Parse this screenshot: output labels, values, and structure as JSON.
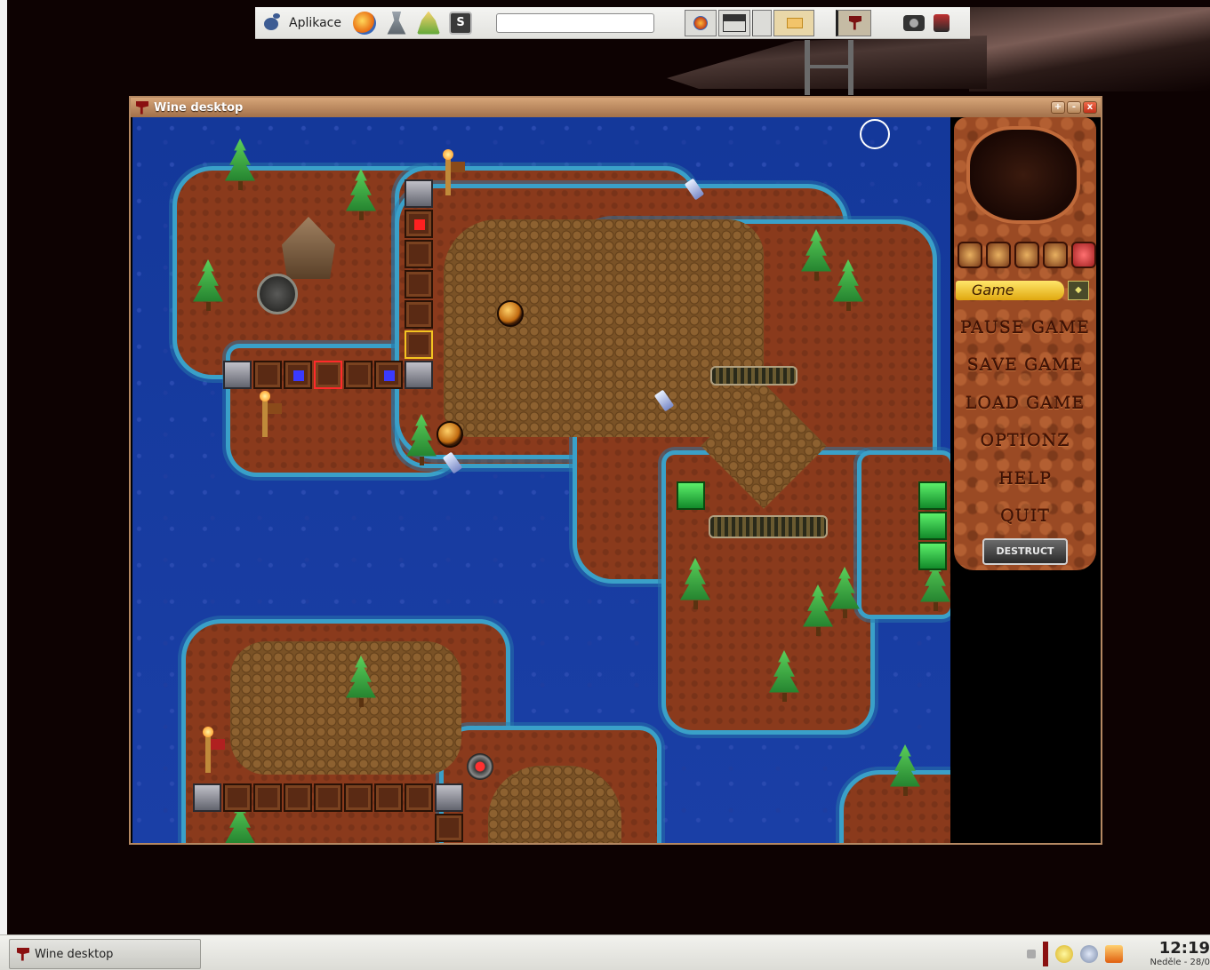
{
  "top_panel": {
    "applications_label": "Aplikace",
    "launchers": [
      "gnome-foot-icon",
      "firefox-icon",
      "network-icon",
      "user-icon",
      "terminal-icon"
    ],
    "run_field_value": ""
  },
  "wine_window": {
    "title": "Wine desktop",
    "controls": [
      "+",
      "-",
      "x"
    ]
  },
  "game_menu": {
    "header": "Game",
    "items": [
      "PAUSE GAME",
      "SAVE GAME",
      "LOAD GAME",
      "OPTIONZ",
      "HELP",
      "QUIT"
    ],
    "destruct_label": "DESTRUCT"
  },
  "taskbar": {
    "task_label": "Wine desktop",
    "clock_time": "12:19",
    "clock_date": "Neděle - 28/0"
  },
  "colors": {
    "water": "#1a3fa6",
    "land": "#8a3a1c",
    "dirt": "#7a5226",
    "panel_menu_header": "#ffe66a"
  }
}
